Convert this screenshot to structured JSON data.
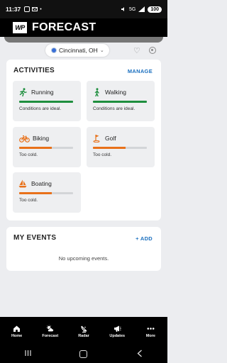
{
  "status": {
    "time": "11:37",
    "network": "5G",
    "battery": "100"
  },
  "header": {
    "logo": "WP",
    "title": "FORECAST"
  },
  "location": {
    "name": "Cincinnati, OH"
  },
  "activities": {
    "title": "ACTIVITIES",
    "action": "MANAGE",
    "tiles": [
      {
        "name": "Running",
        "status": "Conditions are ideal.",
        "level": 1.0,
        "color": "#1e8e3e",
        "icon": "runner-icon"
      },
      {
        "name": "Walking",
        "status": "Conditions are ideal.",
        "level": 1.0,
        "color": "#1e8e3e",
        "icon": "walker-icon"
      },
      {
        "name": "Biking",
        "status": "Too cold.",
        "level": 0.6,
        "color": "#e8711a",
        "icon": "bicycle-icon"
      },
      {
        "name": "Golf",
        "status": "Too cold.",
        "level": 0.6,
        "color": "#e8711a",
        "icon": "golf-flag-icon"
      },
      {
        "name": "Boating",
        "status": "Too cold.",
        "level": 0.6,
        "color": "#e8711a",
        "icon": "sailboat-icon"
      }
    ]
  },
  "events": {
    "title": "MY EVENTS",
    "action": "+ ADD",
    "empty": "No upcoming events."
  },
  "nav": [
    {
      "label": "Home",
      "icon": "home-icon"
    },
    {
      "label": "Forecast",
      "icon": "sun-cloud-icon"
    },
    {
      "label": "Radar",
      "icon": "radar-icon"
    },
    {
      "label": "Updates",
      "icon": "megaphone-icon"
    },
    {
      "label": "More",
      "icon": "dots-icon"
    }
  ]
}
